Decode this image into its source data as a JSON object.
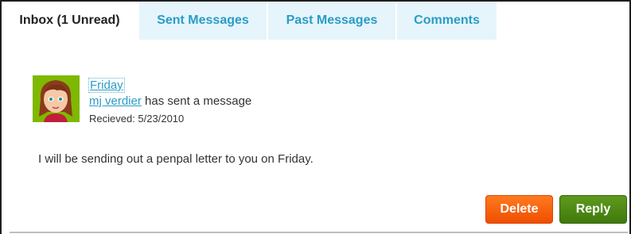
{
  "tabs": [
    {
      "label": "Inbox (1 Unread)",
      "active": true
    },
    {
      "label": "Sent Messages",
      "active": false
    },
    {
      "label": "Past Messages",
      "active": false
    },
    {
      "label": "Comments",
      "active": false
    }
  ],
  "message": {
    "subject": "Friday",
    "sender_name": "mj verdier",
    "sender_suffix": " has sent a message",
    "received": "Recieved: 5/23/2010",
    "body": "I will be sending out a penpal letter to you on Friday."
  },
  "actions": {
    "delete_label": "Delete",
    "reply_label": "Reply"
  },
  "colors": {
    "link": "#2a9cc7",
    "tab_inactive_bg": "#e5f5fb",
    "delete": "#f25a00",
    "reply": "#4b8614",
    "avatar_bg": "#7fb800"
  }
}
